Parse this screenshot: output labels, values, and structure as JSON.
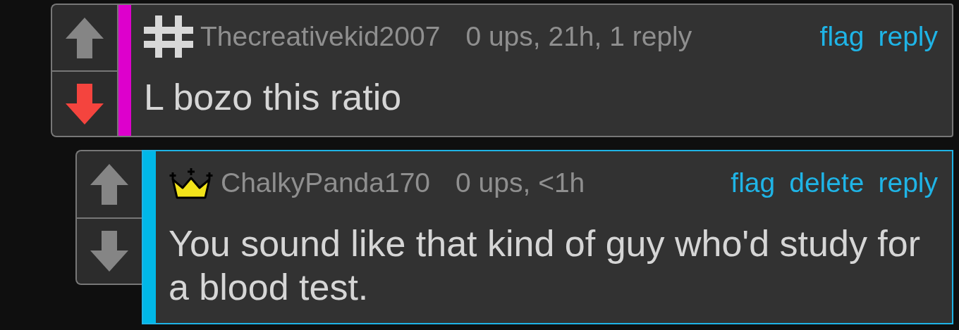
{
  "comments": [
    {
      "kind": "hash",
      "username": "Thecreativekid2007",
      "meta": "0 ups, 21h, 1 reply",
      "actions": [
        "flag",
        "reply"
      ],
      "text": "L bozo this ratio",
      "color": "#dd00cc",
      "upvoted": false,
      "downvoted": true,
      "highlighted": false,
      "children": [
        {
          "kind": "crown",
          "username": "ChalkyPanda170",
          "meta": "0 ups, <1h",
          "actions": [
            "flag",
            "delete",
            "reply"
          ],
          "text": "You sound like that kind of guy who'd study for a blood test.",
          "color": "#00b8e8",
          "upvoted": false,
          "downvoted": false,
          "highlighted": true
        }
      ]
    }
  ]
}
